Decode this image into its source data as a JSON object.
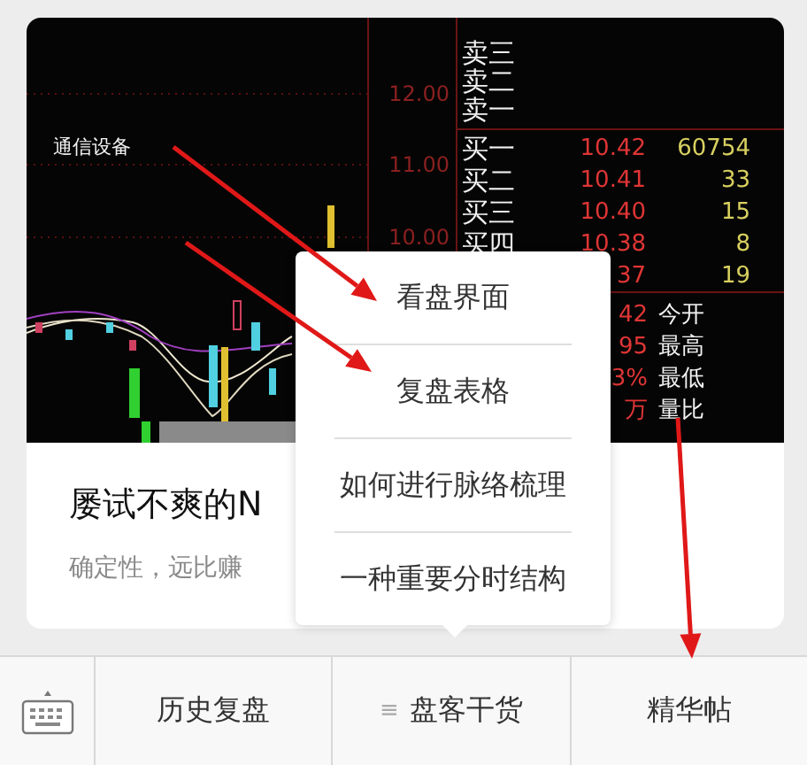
{
  "article_card": {
    "cover": {
      "sector_label": "通信设备",
      "price_ticks": [
        "12.00",
        "11.00",
        "10.00"
      ],
      "sell_rows": [
        {
          "label": "卖三"
        },
        {
          "label": "卖二"
        },
        {
          "label": "卖一"
        }
      ],
      "buy_rows": [
        {
          "label": "买一",
          "price": "10.42",
          "volume": "60754"
        },
        {
          "label": "买二",
          "price": "10.41",
          "volume": "33"
        },
        {
          "label": "买三",
          "price": "10.40",
          "volume": "15"
        },
        {
          "label": "买四",
          "price": "10.38",
          "volume": "8"
        },
        {
          "price": "37",
          "volume": "19"
        }
      ],
      "left_column_values": [
        "42",
        "95",
        "3%",
        "万"
      ],
      "right_column_labels": [
        "今开",
        "最高",
        "最低",
        "量比"
      ]
    },
    "title": "屡试不爽的N",
    "summary": "确定性，远比赚"
  },
  "popup_menu": {
    "items": [
      "看盘界面",
      "复盘表格",
      "如何进行脉络梳理",
      "一种重要分时结构"
    ]
  },
  "bottom_bar": {
    "menus": [
      {
        "label": "历史复盘"
      },
      {
        "prefix": "≡",
        "label": "盘客干货"
      },
      {
        "label": "精华帖"
      }
    ]
  }
}
